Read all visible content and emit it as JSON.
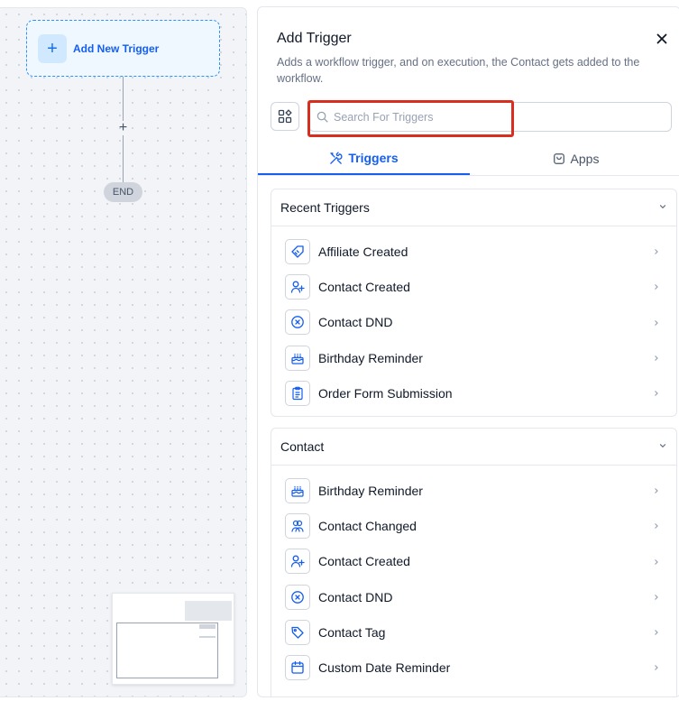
{
  "canvas": {
    "trigger_label": "Add New Trigger",
    "connector_plus": "+",
    "end_label": "END"
  },
  "panel": {
    "title": "Add Trigger",
    "description": "Adds a workflow trigger, and on execution, the Contact gets added to the workflow.",
    "search_placeholder": "Search For Triggers",
    "search_value": "",
    "tabs": [
      {
        "label": "Triggers",
        "icon": "tools-icon",
        "active": true
      },
      {
        "label": "Apps",
        "icon": "app-bag-icon",
        "active": false
      }
    ],
    "sections": [
      {
        "title": "Recent Triggers",
        "items": [
          {
            "label": "Affiliate Created",
            "icon": "affiliate-tag-icon"
          },
          {
            "label": "Contact Created",
            "icon": "user-plus-icon"
          },
          {
            "label": "Contact DND",
            "icon": "x-circle-icon"
          },
          {
            "label": "Birthday Reminder",
            "icon": "cake-icon"
          },
          {
            "label": "Order Form Submission",
            "icon": "clipboard-icon"
          }
        ]
      },
      {
        "title": "Contact",
        "items": [
          {
            "label": "Birthday Reminder",
            "icon": "cake-icon"
          },
          {
            "label": "Contact Changed",
            "icon": "users-icon"
          },
          {
            "label": "Contact Created",
            "icon": "user-plus-icon"
          },
          {
            "label": "Contact DND",
            "icon": "x-circle-icon"
          },
          {
            "label": "Contact Tag",
            "icon": "tag-icon"
          },
          {
            "label": "Custom Date Reminder",
            "icon": "calendar-icon"
          }
        ]
      }
    ]
  },
  "colors": {
    "accent": "#155eef",
    "highlight_border": "#d92d20",
    "canvas_bg": "#f2f4f7"
  }
}
